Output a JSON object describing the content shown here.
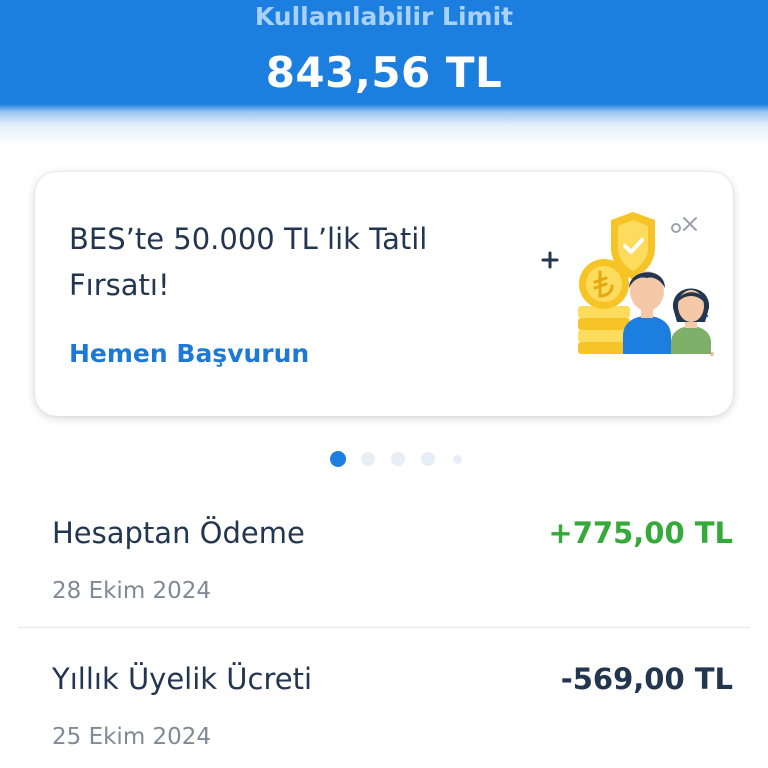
{
  "header": {
    "limit_label": "Kullanılabilir Limit",
    "limit_amount": "843,56 TL",
    "background_color": "#1c7fdf"
  },
  "promo": {
    "title": "BES’te 50.000 TL’lik Tatil Fırsatı!",
    "link_label": "Hemen Başvurun",
    "link_color": "#1c79d6",
    "illustration_icons": [
      "shield-check-icon",
      "coin-stack-icon",
      "family-icon",
      "sparkle-icon"
    ]
  },
  "carousel": {
    "page_count": 5,
    "active_index": 0,
    "active_color": "#1c7fdf"
  },
  "transactions": [
    {
      "title": "Hesaptan Ödeme",
      "amount": "+775,00 TL",
      "date": "28 Ekim 2024",
      "amount_color": "#35a93a"
    },
    {
      "title": "Yıllık Üyelik Ücreti",
      "amount": "-569,00 TL",
      "date": "25 Ekim 2024",
      "amount_color": "#22364f"
    }
  ]
}
